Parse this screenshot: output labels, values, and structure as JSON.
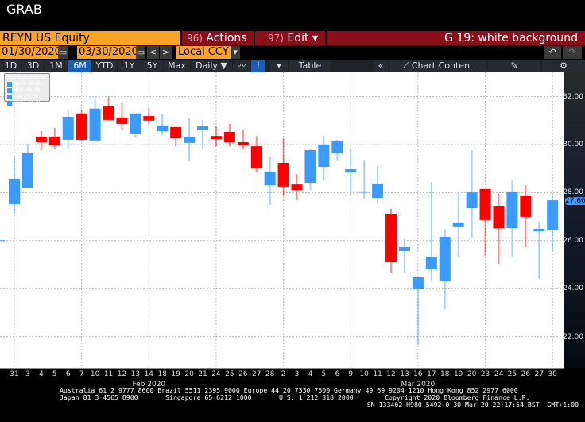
{
  "header": {
    "title": "GRAB"
  },
  "toolbar": {
    "security": "REYN US Equity",
    "actions_num": "96)",
    "actions": "Actions ▾",
    "edit_num": "97)",
    "edit": "Edit ▾",
    "function_title": "G 19: white background",
    "start_date": "01/30/2020",
    "end_date": "03/30/2020",
    "dash": "-",
    "currency": "Local CCY",
    "prev": "<",
    "next": ">",
    "undo": "↶",
    "redo": "↷"
  },
  "periods": [
    {
      "label": "1D"
    },
    {
      "label": "3D"
    },
    {
      "label": "1M"
    },
    {
      "label": "6M",
      "active": true
    },
    {
      "label": "YTD"
    },
    {
      "label": "1Y"
    },
    {
      "label": "5Y"
    },
    {
      "label": "Max"
    },
    {
      "label": "Daily ▼"
    }
  ],
  "tools": {
    "table": "Table",
    "collapse": "«",
    "chart_content": "Chart Content"
  },
  "legend": {
    "title": "REYN US Equity",
    "rows": [
      "Open  26.00",
      "High  26.00",
      "Low   26.00",
      "Close 26.00"
    ]
  },
  "footer": {
    "line1": "Australia 61 2 9777 8600 Brazil 5511 2395 9000 Europe 44 20 7330 7500 Germany 49 69 9204 1210 Hong Kong 852 2977 6000",
    "line2": "Japan 81 3 4565 8900       Singapore 65 6212 1000       U.S. 1 212 318 2000        Copyright 2020 Bloomberg Finance L.P.",
    "line3": "SN 133402 H980-5492-0 30-Mar-20 22:17:54 BST  GMT+1:00"
  },
  "colors": {
    "up": "#3a9bff",
    "down": "#ff0000",
    "accent": "#f8a227",
    "bar": "#8b0e1b"
  },
  "chart_data": {
    "type": "candlestick",
    "ylim": [
      21.3,
      32.3
    ],
    "yticks": [
      "32.00",
      "30.00",
      "28.00",
      "26.00",
      "24.00",
      "22.00"
    ],
    "last_price": "27.66",
    "grid": true,
    "months": [
      {
        "label": "Feb 2020",
        "index": 10
      },
      {
        "label": "Mar 2020",
        "index": 30
      }
    ],
    "x": [
      "31",
      "3",
      "4",
      "5",
      "6",
      "7",
      "10",
      "11",
      "12",
      "13",
      "14",
      "18",
      "19",
      "20",
      "21",
      "24",
      "25",
      "26",
      "27",
      "28",
      "2",
      "3",
      "4",
      "5",
      "6",
      "9",
      "10",
      "11",
      "12",
      "13",
      "16",
      "17",
      "18",
      "19",
      "20",
      "23",
      "24",
      "25",
      "26",
      "27",
      "30"
    ],
    "ohlc": [
      [
        27.52,
        29.5,
        27.15,
        28.58
      ],
      [
        28.21,
        30.03,
        28.21,
        29.64
      ],
      [
        30.33,
        30.56,
        29.77,
        30.1
      ],
      [
        30.33,
        30.7,
        29.8,
        29.97
      ],
      [
        30.2,
        31.46,
        29.8,
        31.16
      ],
      [
        31.3,
        31.42,
        30.13,
        30.2
      ],
      [
        30.17,
        31.89,
        30.17,
        31.5
      ],
      [
        31.62,
        31.99,
        31.03,
        31.03
      ],
      [
        31.13,
        31.75,
        30.63,
        30.86
      ],
      [
        30.46,
        31.3,
        30.3,
        31.3
      ],
      [
        31.19,
        31.52,
        30.86,
        31.0
      ],
      [
        30.56,
        31.26,
        30.4,
        30.8
      ],
      [
        30.73,
        30.73,
        29.93,
        30.26
      ],
      [
        30.07,
        31.09,
        29.34,
        30.33
      ],
      [
        30.6,
        31.03,
        29.8,
        30.76
      ],
      [
        30.36,
        30.76,
        29.93,
        30.23
      ],
      [
        30.53,
        30.86,
        29.93,
        30.1
      ],
      [
        30.1,
        30.6,
        29.8,
        29.97
      ],
      [
        29.93,
        30.36,
        28.87,
        29.0
      ],
      [
        28.31,
        29.5,
        27.48,
        28.87
      ],
      [
        29.24,
        30.26,
        27.85,
        28.25
      ],
      [
        28.34,
        28.77,
        27.68,
        28.11
      ],
      [
        28.41,
        29.83,
        28.11,
        29.77
      ],
      [
        29.07,
        30.36,
        28.51,
        30.0
      ],
      [
        29.64,
        30.2,
        29.34,
        30.17
      ],
      [
        28.84,
        29.83,
        27.88,
        28.97
      ],
      [
        28.0,
        29.37,
        27.75,
        28.05
      ],
      [
        27.78,
        29.1,
        27.55,
        28.38
      ],
      [
        27.12,
        27.32,
        24.64,
        25.1
      ],
      [
        25.56,
        26.06,
        24.67,
        25.73
      ],
      [
        23.97,
        24.47,
        21.66,
        24.47
      ],
      [
        24.8,
        28.44,
        24.34,
        25.33
      ],
      [
        24.3,
        26.49,
        23.15,
        26.16
      ],
      [
        26.56,
        28.05,
        25.33,
        26.76
      ],
      [
        27.35,
        29.77,
        26.13,
        28.01
      ],
      [
        28.15,
        28.15,
        25.36,
        26.86
      ],
      [
        27.45,
        27.98,
        25.03,
        26.52
      ],
      [
        26.52,
        28.51,
        25.33,
        28.05
      ],
      [
        27.88,
        28.31,
        25.73,
        26.99
      ],
      [
        26.39,
        26.79,
        24.4,
        26.49
      ],
      [
        26.46,
        27.91,
        25.56,
        27.68
      ]
    ]
  }
}
